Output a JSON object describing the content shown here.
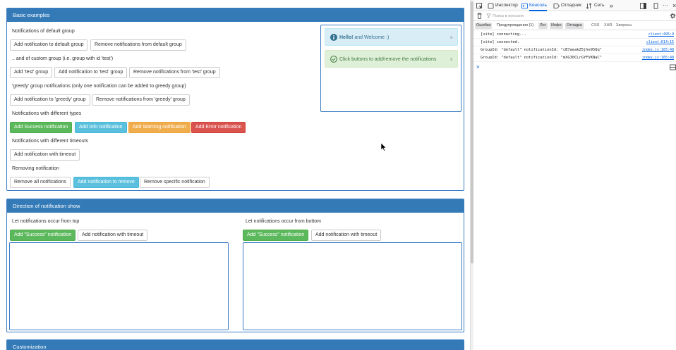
{
  "basic": {
    "title": "Basic examples",
    "default_group_label": "Notifications of default group",
    "add_default": "Add notification to default group",
    "remove_default": "Remove notifications from default group",
    "custom_group_label": ".. and of custom group (i.e. group with id 'test')",
    "add_test_group": "Add 'test' group",
    "add_to_test": "Add notification to 'test' group",
    "remove_test": "Remove notifications from 'test' group",
    "greedy_label": "'greedy' group notifications (only one notification can be added to greedy group)",
    "add_greedy": "Add notification to 'greedy' group",
    "remove_greedy": "Remove notifications from 'greedy' group",
    "types_label": "Notifications with different types",
    "add_success": "Add Success notification",
    "add_info": "Add Info notification",
    "add_warning": "Add Warning notification",
    "add_error": "Add Error notification",
    "timeouts_label": "Notifications with different timeouts",
    "add_timeout": "Add notification with timeout",
    "removing_label": "Removing notification",
    "remove_all": "Remove all notifications",
    "add_to_remove": "Add notification to remove",
    "remove_specific": "Remove specific notification"
  },
  "notifications": [
    {
      "type": "info",
      "bold": "Hello!",
      "text": " and Welcome :)",
      "close": "×",
      "icon": "info-circle-icon"
    },
    {
      "type": "success",
      "bold": "",
      "text": "Click buttons to add/remove the notifications",
      "close": "×",
      "icon": "check-circle-icon"
    }
  ],
  "direction": {
    "title": "Direction of notification show",
    "top_label": "Let notifications occur from top",
    "bottom_label": "Let notifications occur from bottom",
    "add_success": "Add \"Success\" notification",
    "add_timeout": "Add notification with timeout"
  },
  "customization": {
    "title": "Customization"
  },
  "devtools": {
    "tabs": [
      "Инспектор",
      "Консоль",
      "Отладчик",
      "Сеть"
    ],
    "active_tab": "Консоль",
    "filter_placeholder": "Поиск в консоли",
    "categories": [
      "Ошибки",
      "Предупреждения (1)",
      "Лог",
      "Инфо",
      "Отладка"
    ],
    "extra_categories": [
      "CSS",
      "XHR",
      "Запросы"
    ],
    "logs": [
      {
        "msg": "[vite] connecting...",
        "src": "client:495:9"
      },
      {
        "msg": "[vite] connected.",
        "src": "client:614:15"
      },
      {
        "msg": "GroupId: \"default\" notificationId: \"cB7aeakZ5jhe95Qq\"",
        "src": "index.js:165:48"
      },
      {
        "msg": "GroupId: \"default\" notificationId: \"mXG30CLrGYFVKNaC\"",
        "src": "index.js:165:48"
      }
    ],
    "prompt": "»"
  },
  "colors": {
    "primary": "#337ab7",
    "success": "#5cb85c",
    "info": "#5bc0de",
    "warning": "#f0ad4e",
    "danger": "#d9534f",
    "devtools_accent": "#0060df"
  }
}
